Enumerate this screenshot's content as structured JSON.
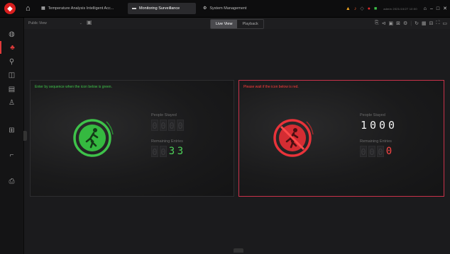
{
  "titlebar": {
    "logo": "◆",
    "tabs": [
      {
        "label": "Temperature Analysis Intelligent Acc...",
        "icon": "grid-icon"
      },
      {
        "label": "Monitoring Surveillance",
        "icon": "video-icon"
      },
      {
        "label": "System Management",
        "icon": "gear-icon"
      }
    ],
    "user_label": "admin  2021/10/27 10:00",
    "alert_colors": {
      "warn": "#f2a51f",
      "danger": "#e32b2b",
      "ok": "#3ec24a"
    }
  },
  "toolbar": {
    "view_select": "Public View",
    "live_view_label": "Live View",
    "playback_label": "Playback"
  },
  "left_panel": {
    "message": "Enter by sequence when the icon below is green.",
    "people_stayed_label": "People Stayed",
    "people_stayed_digits": [
      "0",
      "0",
      "0",
      "0"
    ],
    "remaining_label": "Remaining Entries",
    "remaining_digits": [
      "0",
      "0",
      "3",
      "3"
    ],
    "remaining_lit": [
      false,
      false,
      true,
      true
    ],
    "status_color": "#3ec24a"
  },
  "right_panel": {
    "message": "Please wait if the icon below is red.",
    "people_stayed_label": "People Stayed",
    "people_stayed_digits": [
      "1",
      "0",
      "0",
      "0"
    ],
    "remaining_label": "Remaining Entries",
    "remaining_digits": [
      "0",
      "0",
      "0",
      "0"
    ],
    "remaining_lit": [
      false,
      false,
      false,
      true
    ],
    "status_color": "#ff3b3b"
  }
}
